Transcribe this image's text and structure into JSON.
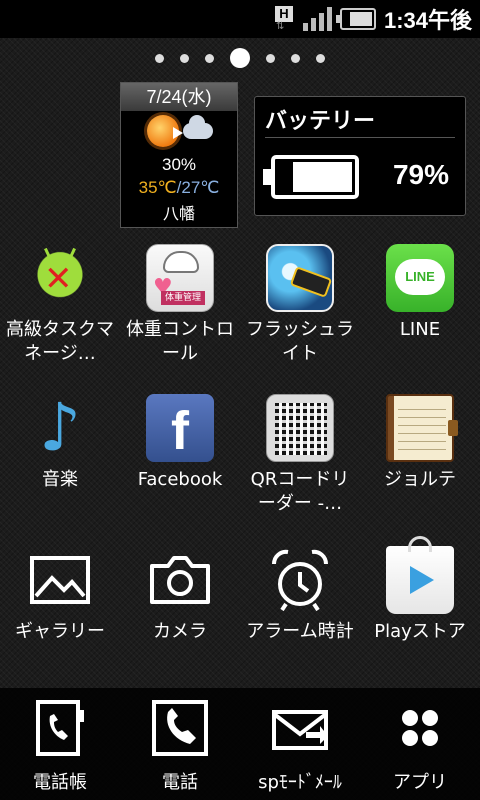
{
  "status_bar": {
    "network_letter": "H",
    "network_arrows": "⇅",
    "time": "1:34午後"
  },
  "home": {
    "page_count": 7,
    "active_page": 4
  },
  "weather": {
    "date": "7/24(水)",
    "precipitation": "30%",
    "high": "35℃",
    "separator": "/",
    "low": "27℃",
    "location": "八幡"
  },
  "battery_widget": {
    "title": "バッテリー",
    "percent": "79%",
    "level": 0.79
  },
  "apps": [
    {
      "label": "高級タスクマネージ…",
      "icon": "task-manager-icon"
    },
    {
      "label": "体重コントロール",
      "icon": "weight-control-icon",
      "badge": "体重管理"
    },
    {
      "label": "フラッシュライト",
      "icon": "flashlight-icon"
    },
    {
      "label": "LINE",
      "icon": "line-icon",
      "icon_text": "LINE"
    },
    {
      "label": "音楽",
      "icon": "music-icon",
      "icon_text": "♪"
    },
    {
      "label": "Facebook",
      "icon": "facebook-icon",
      "icon_text": "f"
    },
    {
      "label": "QRコードリーダー -…",
      "icon": "qr-reader-icon"
    },
    {
      "label": "ジョルテ",
      "icon": "jorte-icon"
    },
    {
      "label": "ギャラリー",
      "icon": "gallery-icon"
    },
    {
      "label": "カメラ",
      "icon": "camera-icon"
    },
    {
      "label": "アラーム時計",
      "icon": "alarm-clock-icon"
    },
    {
      "label": "Playストア",
      "icon": "play-store-icon"
    }
  ],
  "dock": [
    {
      "label": "電話帳",
      "icon": "contacts-icon"
    },
    {
      "label": "電話",
      "icon": "phone-icon"
    },
    {
      "label": "spﾓｰﾄﾞﾒｰﾙ",
      "icon": "mail-icon"
    },
    {
      "label": "アプリ",
      "icon": "app-drawer-icon"
    }
  ]
}
